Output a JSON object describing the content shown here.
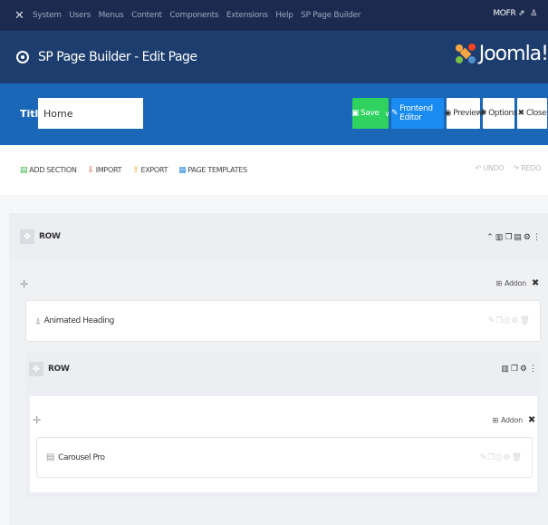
{
  "topnav": {
    "menu": [
      "System",
      "Users",
      "Menus",
      "Content",
      "Components",
      "Extensions",
      "Help",
      "SP Page Builder"
    ],
    "user": "MOFR",
    "user_icon": "person-icon"
  },
  "header": {
    "title": "SP Page Builder - Edit Page",
    "brand": "Joomla!"
  },
  "toolbar": {
    "title_label": "Title *",
    "title_value": "Home",
    "buttons": {
      "save": "Save",
      "frontend": "Frontend Editor",
      "preview": "Preview",
      "options": "Options",
      "close": "Close"
    },
    "colors": {
      "save": "#2fd25f",
      "frontend": "#1a8bf1"
    }
  },
  "subbar": {
    "add_section": "ADD SECTION",
    "import": "IMPORT",
    "export": "EXPORT",
    "page_templates": "PAGE TEMPLATES",
    "undo": "UNDO",
    "redo": "REDO"
  },
  "builder": {
    "row1_label": "ROW",
    "addon_label": "Addon",
    "addon1": "Animated Heading",
    "row2_label": "ROW",
    "addon2_label": "Addon",
    "addon2": "Carousel Pro"
  }
}
